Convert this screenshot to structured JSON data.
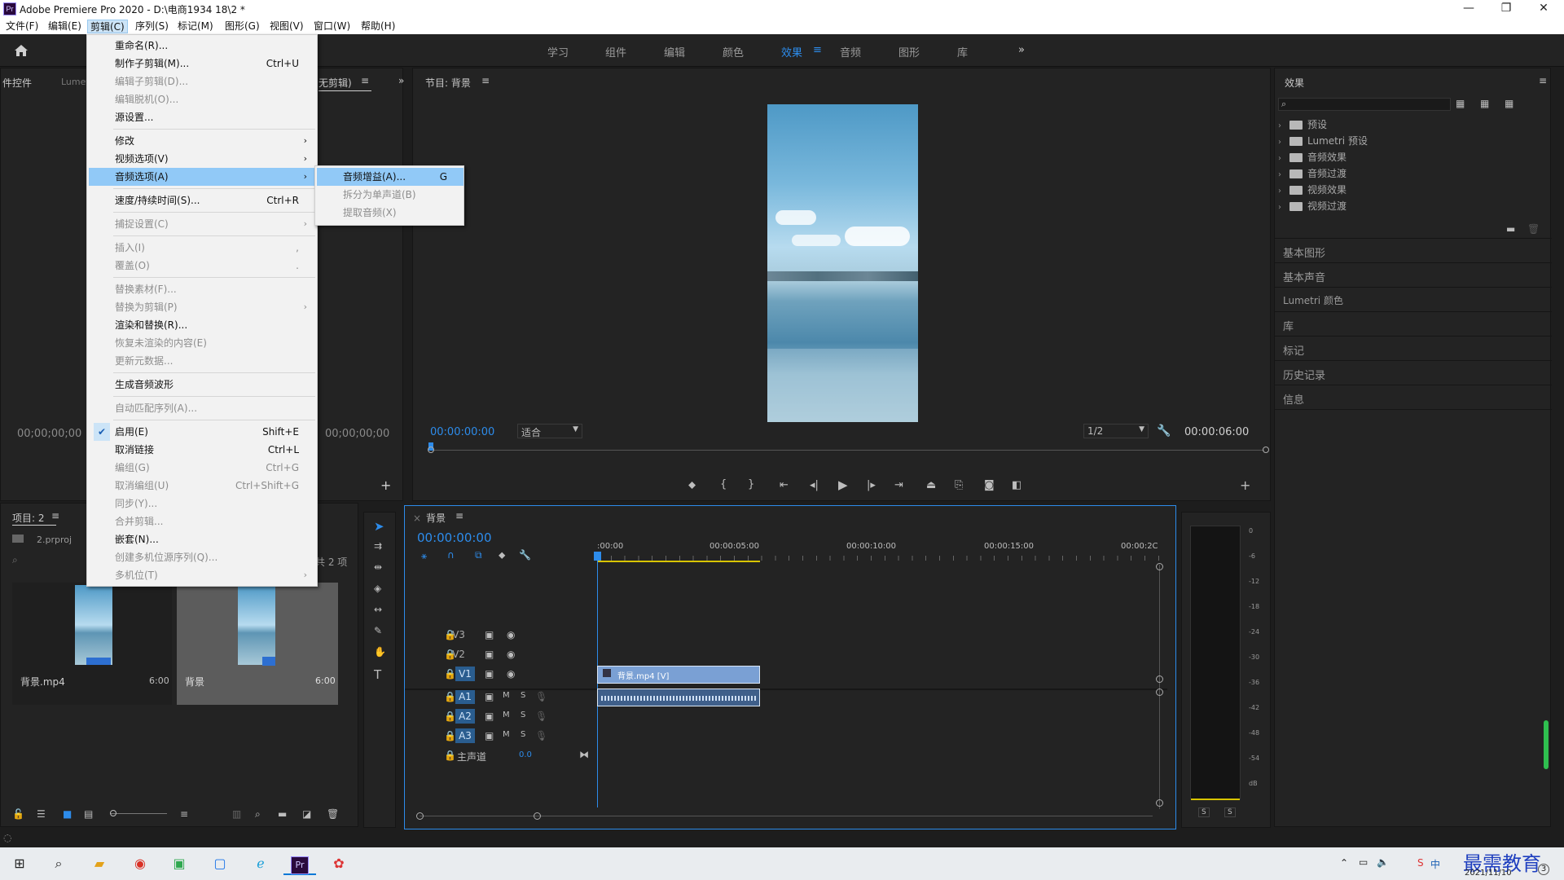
{
  "window": {
    "title": "Adobe Premiere Pro 2020 - D:\\电商1934 18\\2 *",
    "app_badge": "Pr",
    "minimize": "—",
    "maximize": "❐",
    "close": "✕"
  },
  "menubar": [
    "文件(F)",
    "编辑(E)",
    "剪辑(C)",
    "序列(S)",
    "标记(M)",
    "图形(G)",
    "视图(V)",
    "窗口(W)",
    "帮助(H)"
  ],
  "workspaces": {
    "items": [
      "学习",
      "组件",
      "编辑",
      "颜色",
      "效果",
      "音频",
      "图形",
      "库"
    ],
    "active": "效果",
    "more": "»"
  },
  "clip_menu": {
    "items": [
      {
        "label": "重命名(R)...",
        "shortcut": "",
        "enabled": true
      },
      {
        "label": "制作子剪辑(M)...",
        "shortcut": "Ctrl+U",
        "enabled": true
      },
      {
        "label": "编辑子剪辑(D)...",
        "shortcut": "",
        "enabled": false
      },
      {
        "label": "编辑脱机(O)...",
        "shortcut": "",
        "enabled": false
      },
      {
        "label": "源设置...",
        "shortcut": "",
        "enabled": true
      },
      {
        "label": "修改",
        "shortcut": "",
        "enabled": true,
        "submenu": true
      },
      {
        "label": "视频选项(V)",
        "shortcut": "",
        "enabled": true,
        "submenu": true
      },
      {
        "label": "音频选项(A)",
        "shortcut": "",
        "enabled": true,
        "submenu": true,
        "highlighted": true
      },
      {
        "label": "速度/持续时间(S)...",
        "shortcut": "Ctrl+R",
        "enabled": true
      },
      {
        "label": "捕捉设置(C)",
        "shortcut": "",
        "enabled": false,
        "submenu": true
      },
      {
        "label": "插入(I)",
        "shortcut": ",",
        "enabled": false
      },
      {
        "label": "覆盖(O)",
        "shortcut": ".",
        "enabled": false
      },
      {
        "label": "替换素材(F)...",
        "shortcut": "",
        "enabled": false
      },
      {
        "label": "替换为剪辑(P)",
        "shortcut": "",
        "enabled": false,
        "submenu": true
      },
      {
        "label": "渲染和替换(R)...",
        "shortcut": "",
        "enabled": true
      },
      {
        "label": "恢复未渲染的内容(E)",
        "shortcut": "",
        "enabled": false
      },
      {
        "label": "更新元数据...",
        "shortcut": "",
        "enabled": false
      },
      {
        "label": "生成音频波形",
        "shortcut": "",
        "enabled": true
      },
      {
        "label": "自动匹配序列(A)...",
        "shortcut": "",
        "enabled": false
      },
      {
        "label": "启用(E)",
        "shortcut": "Shift+E",
        "enabled": true,
        "checked": true
      },
      {
        "label": "取消链接",
        "shortcut": "Ctrl+L",
        "enabled": true
      },
      {
        "label": "编组(G)",
        "shortcut": "Ctrl+G",
        "enabled": false
      },
      {
        "label": "取消编组(U)",
        "shortcut": "Ctrl+Shift+G",
        "enabled": false
      },
      {
        "label": "同步(Y)...",
        "shortcut": "",
        "enabled": false
      },
      {
        "label": "合并剪辑...",
        "shortcut": "",
        "enabled": false
      },
      {
        "label": "嵌套(N)...",
        "shortcut": "",
        "enabled": true
      },
      {
        "label": "创建多机位源序列(Q)...",
        "shortcut": "",
        "enabled": false
      },
      {
        "label": "多机位(T)",
        "shortcut": "",
        "enabled": false,
        "submenu": true
      }
    ]
  },
  "audio_submenu": {
    "items": [
      {
        "label": "音频增益(A)...",
        "shortcut": "G",
        "enabled": true,
        "highlighted": true
      },
      {
        "label": "拆分为单声道(B)",
        "shortcut": "",
        "enabled": false
      },
      {
        "label": "提取音频(X)",
        "shortcut": "",
        "enabled": false
      }
    ]
  },
  "source_panel": {
    "tab1": "件控件",
    "tab2": "Lumetri",
    "tab3": "无剪辑)",
    "timecode_left": "00;00;00;00",
    "timecode_right": "00;00;00;00",
    "add": "+"
  },
  "program": {
    "title": "节目: 背景",
    "timecode": "00:00:00:00",
    "fit": "适合",
    "resolution": "1/2",
    "duration": "00:00:06:00",
    "add": "+"
  },
  "project": {
    "title": "项目: 2",
    "file": "2.prproj",
    "count": "共 2 项",
    "items": [
      {
        "name": "背景.mp4",
        "duration": "6:00"
      },
      {
        "name": "背景",
        "duration": "6:00"
      }
    ]
  },
  "timeline": {
    "title": "背景",
    "timecode": "00:00:00:00",
    "ruler": [
      ":00:00",
      "00:00:05:00",
      "00:00:10:00",
      "00:00:15:00",
      "00:00:2C"
    ],
    "tracks_video": [
      "V3",
      "V2",
      "V1"
    ],
    "tracks_audio": [
      "A1",
      "A2",
      "A3"
    ],
    "master_label": "主声道",
    "master_value": "0.0",
    "clip_video": "背景.mp4 [V]",
    "m": "M",
    "s": "S"
  },
  "meter": {
    "scale": [
      "0",
      "-6",
      "-12",
      "-18",
      "-24",
      "-30",
      "-36",
      "-42",
      "-48",
      "-54",
      "dB"
    ],
    "s1": "S",
    "s2": "S"
  },
  "effects": {
    "title": "效果",
    "folders": [
      "预设",
      "Lumetri 预设",
      "音频效果",
      "音频过渡",
      "视频效果",
      "视频过渡"
    ],
    "panels": [
      "基本图形",
      "基本声音",
      "Lumetri 颜色",
      "库",
      "标记",
      "历史记录",
      "信息"
    ]
  },
  "taskbar": {
    "ime": "中",
    "date": "2021/11/10",
    "watermark": "最需教育",
    "notif": "3"
  },
  "colors": {
    "accent": "#2d8ceb",
    "panel_bg": "#232323",
    "clip_video": "#7aa0d4",
    "clip_audio": "#3f5f8a"
  }
}
